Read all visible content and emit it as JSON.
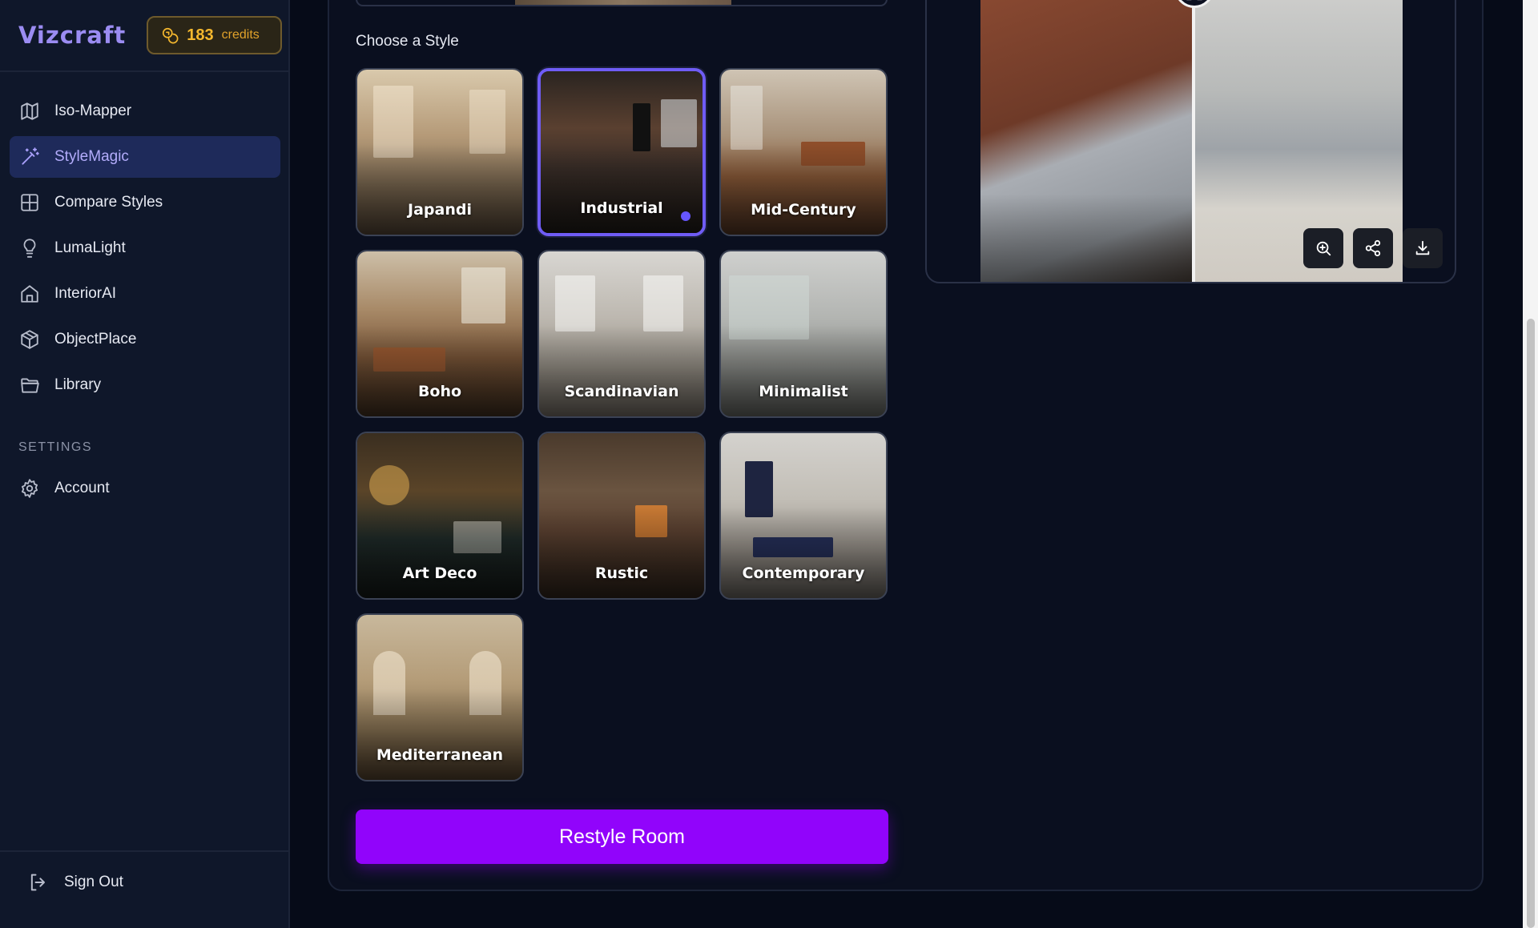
{
  "app": {
    "name": "Vizcraft"
  },
  "credits": {
    "count": "183",
    "label": "credits"
  },
  "sidebar": {
    "items": [
      {
        "label": "Iso-Mapper",
        "icon": "map-icon",
        "active": false
      },
      {
        "label": "StyleMagic",
        "icon": "magic-wand-icon",
        "active": true
      },
      {
        "label": "Compare Styles",
        "icon": "grid-icon",
        "active": false
      },
      {
        "label": "LumaLight",
        "icon": "lightbulb-icon",
        "active": false
      },
      {
        "label": "InteriorAI",
        "icon": "home-icon",
        "active": false
      },
      {
        "label": "ObjectPlace",
        "icon": "cube-icon",
        "active": false
      },
      {
        "label": "Library",
        "icon": "folder-icon",
        "active": false
      }
    ],
    "settings_title": "SETTINGS",
    "settings_items": [
      {
        "label": "Account",
        "icon": "gear-icon"
      }
    ],
    "sign_out": "Sign Out"
  },
  "main": {
    "choose_style_label": "Choose a Style",
    "styles": [
      {
        "name": "Japandi",
        "selected": false
      },
      {
        "name": "Industrial",
        "selected": true
      },
      {
        "name": "Mid-Century",
        "selected": false
      },
      {
        "name": "Boho",
        "selected": false
      },
      {
        "name": "Scandinavian",
        "selected": false
      },
      {
        "name": "Minimalist",
        "selected": false
      },
      {
        "name": "Art Deco",
        "selected": false
      },
      {
        "name": "Rustic",
        "selected": false
      },
      {
        "name": "Contemporary",
        "selected": false
      },
      {
        "name": "Mediterranean",
        "selected": false
      }
    ],
    "restyle_button": "Restyle Room"
  },
  "preview": {
    "tools": [
      "zoom-in-icon",
      "share-icon",
      "download-icon"
    ]
  },
  "colors": {
    "accent": "#9104fb",
    "selection": "#6f5cf5",
    "credits": "#f5b82e",
    "active_nav": "#1e2a5a"
  }
}
